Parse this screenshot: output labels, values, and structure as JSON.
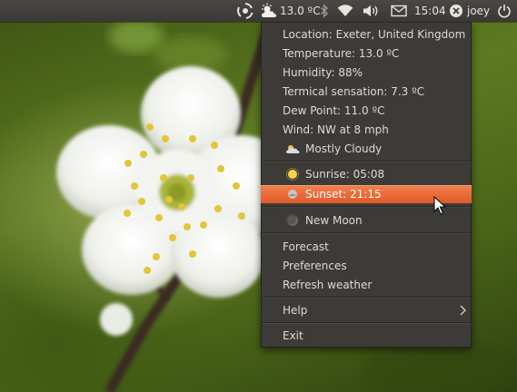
{
  "panel": {
    "weather_icon": "partly-cloudy-icon",
    "temperature": "13.0 ºC",
    "time": "15:04",
    "user": "joey",
    "icons": [
      "ubuntu-swirl-icon",
      "partly-cloudy-icon",
      "bluetooth-icon",
      "wifi-icon",
      "volume-icon",
      "mail-icon",
      "user-status-icon",
      "power-icon"
    ]
  },
  "menu": {
    "location": "Location: Exeter, United Kingdom",
    "temperature": "Temperature: 13.0 ºC",
    "humidity": "Humidity: 88%",
    "sensation": "Termical sensation: 7.3 ºC",
    "dew_point": "Dew Point: 11.0 ºC",
    "wind": "Wind: NW at 8 mph",
    "condition": "Mostly Cloudy",
    "sunrise": "Sunrise: 05:08",
    "sunset": "Sunset: 21:15",
    "moon": "New Moon",
    "forecast": "Forecast",
    "preferences": "Preferences",
    "refresh": "Refresh weather",
    "help": "Help",
    "exit": "Exit"
  },
  "colors": {
    "panel_bg": "#3c3b37",
    "menu_bg": "#3c3b37",
    "highlight": "#f07746",
    "text": "#dfdbd2"
  }
}
